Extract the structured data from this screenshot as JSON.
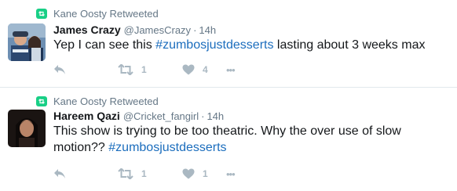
{
  "tweets": [
    {
      "retweeted_by": "Kane Oosty Retweeted",
      "fullname": "James Crazy",
      "username": "@JamesCrazy",
      "separator": "·",
      "time": "14h",
      "text_before": "Yep I can see this ",
      "hashtag": "#zumbosjustdesserts",
      "text_after": " lasting about 3 weeks max",
      "retweet_count": "1",
      "like_count": "4",
      "more_label": "•••"
    },
    {
      "retweeted_by": "Kane Oosty Retweeted",
      "fullname": "Hareem Qazi",
      "username": "@Cricket_fangirl",
      "separator": "·",
      "time": "14h",
      "text_before": "This show is trying to be too theatric. Why the over use of slow motion?? ",
      "hashtag": "#zumbosjustdesserts",
      "text_after": "",
      "retweet_count": "1",
      "like_count": "1",
      "more_label": "•••"
    }
  ],
  "colors": {
    "retweet_badge": "#19cf86",
    "hashtag": "#1b6dbd",
    "muted": "#657786",
    "icon": "#aab8c2"
  },
  "icons": {
    "retweet_badge": "retweet-icon",
    "reply": "reply-icon",
    "retweet": "retweet-icon",
    "like": "heart-icon",
    "more": "more-icon"
  }
}
